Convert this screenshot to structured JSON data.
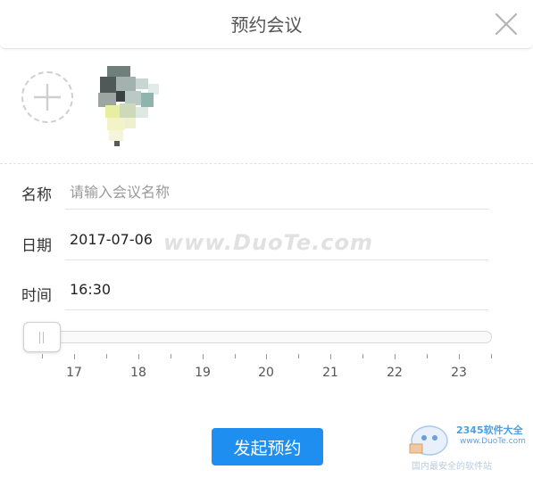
{
  "dialog": {
    "title": "预约会议",
    "close_icon": "close-icon"
  },
  "participants": {
    "add_icon": "plus-icon"
  },
  "form": {
    "name": {
      "label": "名称",
      "placeholder": "请输入会议名称",
      "value": ""
    },
    "date": {
      "label": "日期",
      "value": "2017-07-06"
    },
    "time": {
      "label": "时间",
      "value": "16:30"
    }
  },
  "time_slider": {
    "tick_labels": [
      "17",
      "18",
      "19",
      "20",
      "21",
      "22",
      "23"
    ],
    "handle_position_fraction": 0.0
  },
  "submit": {
    "label": "发起预约"
  },
  "watermarks": {
    "center": "www.DuoTe.com",
    "logo_brand": "2345软件大全",
    "logo_url": "www.DuoTe.com",
    "logo_slogan": "国内最安全的软件站"
  },
  "colors": {
    "accent": "#1f8ef1",
    "divider": "#e3e3e3"
  }
}
